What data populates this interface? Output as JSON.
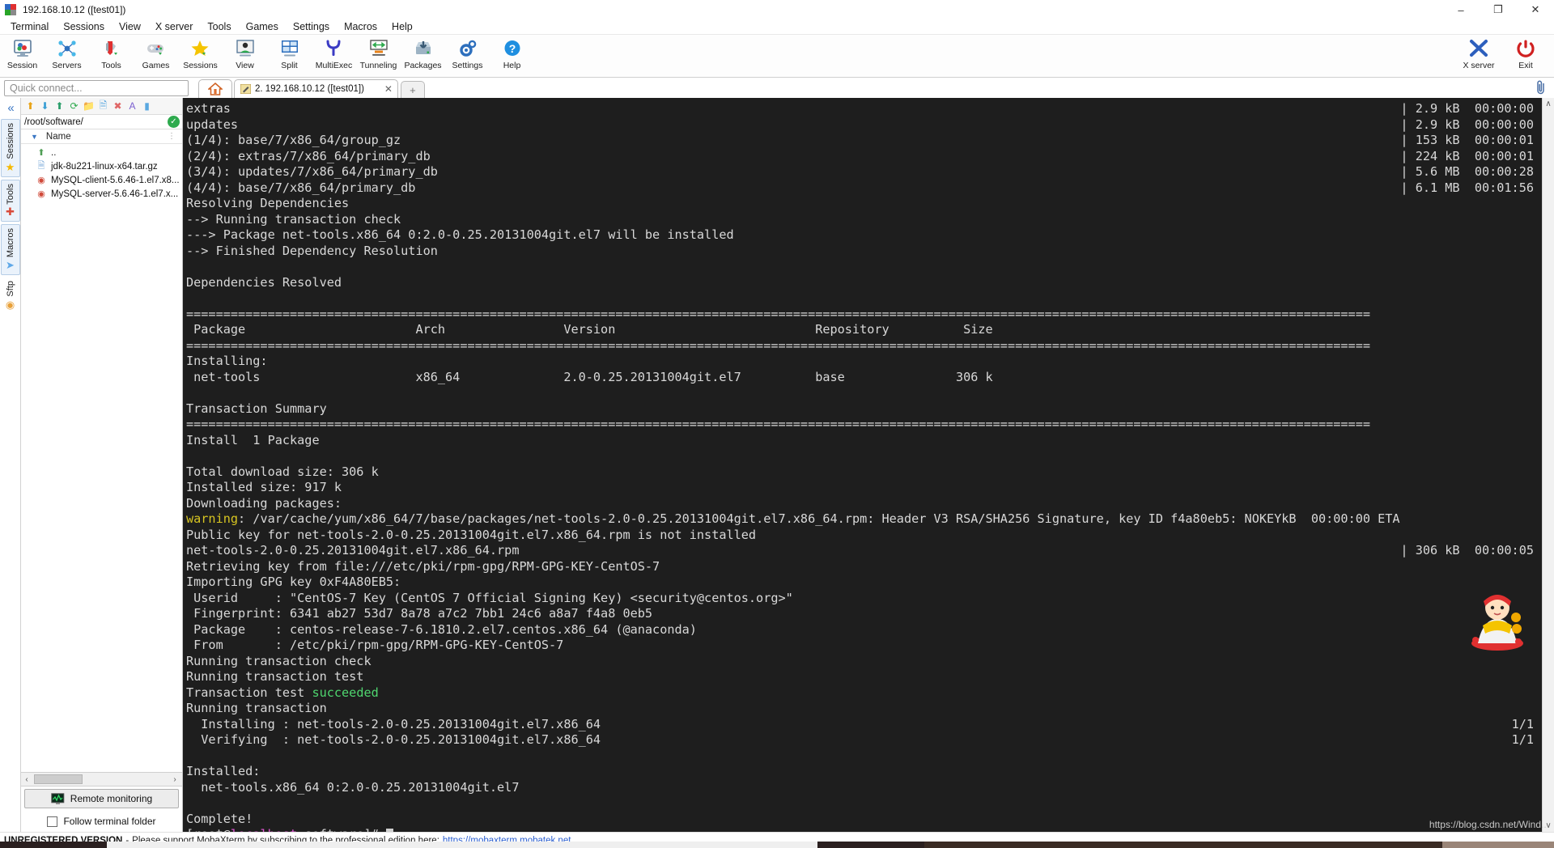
{
  "window": {
    "title": "192.168.10.12 ([test01])",
    "icon": "mobaxterm-icon",
    "minimize": "–",
    "maximize": "❐",
    "close": "✕"
  },
  "menubar": {
    "items": [
      "Terminal",
      "Sessions",
      "View",
      "X server",
      "Tools",
      "Games",
      "Settings",
      "Macros",
      "Help"
    ]
  },
  "toolbar": {
    "items": [
      {
        "label": "Session",
        "icon": "session-monitor-icon",
        "glyph": "🖥"
      },
      {
        "label": "Servers",
        "icon": "servers-network-icon",
        "glyph": "⚙"
      },
      {
        "label": "Tools",
        "icon": "tools-knife-icon",
        "glyph": "🔧"
      },
      {
        "label": "Games",
        "icon": "games-gamepad-icon",
        "glyph": "🎮"
      },
      {
        "label": "Sessions",
        "icon": "sessions-star-icon",
        "glyph": "★"
      },
      {
        "label": "View",
        "icon": "view-screen-icon",
        "glyph": "🖵"
      },
      {
        "label": "Split",
        "icon": "split-panes-icon",
        "glyph": "▦"
      },
      {
        "label": "MultiExec",
        "icon": "multiexec-fork-icon",
        "glyph": "Ψ"
      },
      {
        "label": "Tunneling",
        "icon": "tunneling-arrows-icon",
        "glyph": "↔"
      },
      {
        "label": "Packages",
        "icon": "packages-download-icon",
        "glyph": "⬇"
      },
      {
        "label": "Settings",
        "icon": "settings-gear-icon",
        "glyph": "⚙"
      },
      {
        "label": "Help",
        "icon": "help-question-icon",
        "glyph": "?"
      }
    ],
    "right_items": [
      {
        "label": "X server",
        "icon": "xserver-x-icon",
        "glyph": "X"
      },
      {
        "label": "Exit",
        "icon": "exit-power-icon",
        "glyph": "⏻"
      }
    ]
  },
  "quick_connect": {
    "placeholder": "Quick connect...",
    "value": ""
  },
  "tabs": {
    "home_icon": "home-icon",
    "session_tab": {
      "icon": "ssh-pencil-icon",
      "label": "2. 192.168.10.12 ([test01])",
      "close": "✕"
    },
    "new_tab": "+",
    "clip_icon": "paperclip-icon"
  },
  "side_tabs": {
    "collapse": "«",
    "items": [
      {
        "label": "Sessions",
        "icon": "star-icon",
        "glyph": "★",
        "color": "#f5b800"
      },
      {
        "label": "Tools",
        "icon": "knife-icon",
        "glyph": "🖊",
        "color": "#d94a3a"
      },
      {
        "label": "Macros",
        "icon": "paperplane-icon",
        "glyph": "➤",
        "color": "#5fa8e8"
      },
      {
        "label": "Sftp",
        "icon": "globe-icon",
        "glyph": "◉",
        "color": "#e8a13a"
      }
    ]
  },
  "file_browser": {
    "tool_icons": [
      {
        "name": "up-folder-icon",
        "glyph": "↑",
        "color": "#e8a317"
      },
      {
        "name": "download-icon",
        "glyph": "⬇",
        "color": "#3b9fd4"
      },
      {
        "name": "upload-icon",
        "glyph": "⬆",
        "color": "#2eaa4e"
      },
      {
        "name": "refresh-icon",
        "glyph": "↻",
        "color": "#2eaa4e"
      },
      {
        "name": "new-folder-icon",
        "glyph": "📁",
        "color": "#e8a317"
      },
      {
        "name": "new-file-icon",
        "glyph": "🗋",
        "color": "#5aa8e0"
      },
      {
        "name": "delete-icon",
        "glyph": "✕",
        "color": "#e06666"
      },
      {
        "name": "text-mode-icon",
        "glyph": "A",
        "color": "#7a5fd0"
      },
      {
        "name": "binary-mode-icon",
        "glyph": "▮",
        "color": "#5aa8e0"
      }
    ],
    "path": "/root/software/",
    "path_ok_icon": "check-circle-icon",
    "column_header": "Name",
    "sort_caret": "▼",
    "files": [
      {
        "name": "..",
        "icon": "parent-folder-icon",
        "glyph": "↑",
        "color": "#6fbf73"
      },
      {
        "name": "jdk-8u221-linux-x64.tar.gz",
        "icon": "archive-file-icon",
        "glyph": "⎇",
        "color": "#7aa8d8"
      },
      {
        "name": "MySQL-client-5.6.46-1.el7.x8...",
        "icon": "rpm-file-icon",
        "glyph": "●",
        "color": "#d04a3a"
      },
      {
        "name": "MySQL-server-5.6.46-1.el7.x...",
        "icon": "rpm-file-icon",
        "glyph": "●",
        "color": "#d04a3a"
      }
    ],
    "hscroll": {
      "left": "‹",
      "right": "›"
    },
    "remote_monitoring": {
      "label": "Remote monitoring",
      "icon": "monitor-graph-icon"
    },
    "follow_terminal_folder": {
      "label": "Follow terminal folder",
      "checked": false
    }
  },
  "terminal": {
    "scroll_up": "∧",
    "scroll_down": "∨",
    "cursor": "block",
    "lines": [
      {
        "text": "extras",
        "right": "| 2.9 kB  00:00:00"
      },
      {
        "text": "updates",
        "right": "| 2.9 kB  00:00:00"
      },
      {
        "text": "(1/4): base/7/x86_64/group_gz",
        "right": "| 153 kB  00:00:01"
      },
      {
        "text": "(2/4): extras/7/x86_64/primary_db",
        "right": "| 224 kB  00:00:01"
      },
      {
        "text": "(3/4): updates/7/x86_64/primary_db",
        "right": "| 5.6 MB  00:00:28"
      },
      {
        "text": "(4/4): base/7/x86_64/primary_db",
        "right": "| 6.1 MB  00:01:56"
      },
      {
        "text": "Resolving Dependencies",
        "right": ""
      },
      {
        "text": "--> Running transaction check",
        "right": ""
      },
      {
        "text": "---> Package net-tools.x86_64 0:2.0-0.25.20131004git.el7 will be installed",
        "right": ""
      },
      {
        "text": "--> Finished Dependency Resolution",
        "right": ""
      },
      {
        "text": "",
        "right": ""
      },
      {
        "text": "Dependencies Resolved",
        "right": ""
      },
      {
        "text": "",
        "right": ""
      },
      {
        "text": "================================================================================================================================================================",
        "right": ""
      },
      {
        "text": " Package                       Arch                Version                           Repository          Size",
        "right": ""
      },
      {
        "text": "================================================================================================================================================================",
        "right": ""
      },
      {
        "text": "Installing:",
        "right": ""
      },
      {
        "text": " net-tools                     x86_64              2.0-0.25.20131004git.el7          base               306 k",
        "right": ""
      },
      {
        "text": "",
        "right": ""
      },
      {
        "text": "Transaction Summary",
        "right": ""
      },
      {
        "text": "================================================================================================================================================================",
        "right": ""
      },
      {
        "text": "Install  1 Package",
        "right": ""
      },
      {
        "text": "",
        "right": ""
      },
      {
        "text": "Total download size: 306 k",
        "right": ""
      },
      {
        "text": "Installed size: 917 k",
        "right": ""
      },
      {
        "text": "Downloading packages:",
        "right": ""
      },
      {
        "text": "warning: /var/cache/yum/x86_64/7/base/packages/net-tools-2.0-0.25.20131004git.el7.x86_64.rpm: Header V3 RSA/SHA256 Signature, key ID f4a80eb5: NOKEYkB  00:00:00 ETA",
        "right": ""
      },
      {
        "text": "Public key for net-tools-2.0-0.25.20131004git.el7.x86_64.rpm is not installed",
        "right": ""
      },
      {
        "text": "net-tools-2.0-0.25.20131004git.el7.x86_64.rpm",
        "right": "| 306 kB  00:00:05"
      },
      {
        "text": "Retrieving key from file:///etc/pki/rpm-gpg/RPM-GPG-KEY-CentOS-7",
        "right": ""
      },
      {
        "text": "Importing GPG key 0xF4A80EB5:",
        "right": ""
      },
      {
        "text": " Userid     : \"CentOS-7 Key (CentOS 7 Official Signing Key) <security@centos.org>\"",
        "right": ""
      },
      {
        "text": " Fingerprint: 6341 ab27 53d7 8a78 a7c2 7bb1 24c6 a8a7 f4a8 0eb5",
        "right": ""
      },
      {
        "text": " Package    : centos-release-7-6.1810.2.el7.centos.x86_64 (@anaconda)",
        "right": ""
      },
      {
        "text": " From       : /etc/pki/rpm-gpg/RPM-GPG-KEY-CentOS-7",
        "right": ""
      },
      {
        "text": "Running transaction check",
        "right": ""
      },
      {
        "text": "Running transaction test",
        "right": ""
      },
      {
        "text": "Transaction test succeeded",
        "right": ""
      },
      {
        "text": "Running transaction",
        "right": ""
      },
      {
        "text": "  Installing : net-tools-2.0-0.25.20131004git.el7.x86_64",
        "right": "1/1"
      },
      {
        "text": "  Verifying  : net-tools-2.0-0.25.20131004git.el7.x86_64",
        "right": "1/1"
      },
      {
        "text": "",
        "right": ""
      },
      {
        "text": "Installed:",
        "right": ""
      },
      {
        "text": "  net-tools.x86_64 0:2.0-0.25.20131004git.el7",
        "right": ""
      },
      {
        "text": "",
        "right": ""
      },
      {
        "text": "Complete!",
        "right": ""
      }
    ],
    "prompt": {
      "bracket_open": "[root@",
      "host": "localhost",
      "rest": " software]# "
    }
  },
  "status_bar": {
    "unregistered": "UNREGISTERED VERSION",
    "dash": "-",
    "message": "Please support MobaXterm by subscribing to the professional edition here:",
    "link": "https://mobaxterm.mobatek.net",
    "watermark": "https://blog.csdn.net/Wind..."
  },
  "colors": {
    "terminal_bg": "#1e1e1e",
    "terminal_fg": "#d8d8d8",
    "warning_yellow": "#d7c521",
    "host_magenta": "#e256d4",
    "success_green": "#4fd66f",
    "link_blue": "#2b5fd0",
    "accent_blue": "#3b77c4"
  }
}
